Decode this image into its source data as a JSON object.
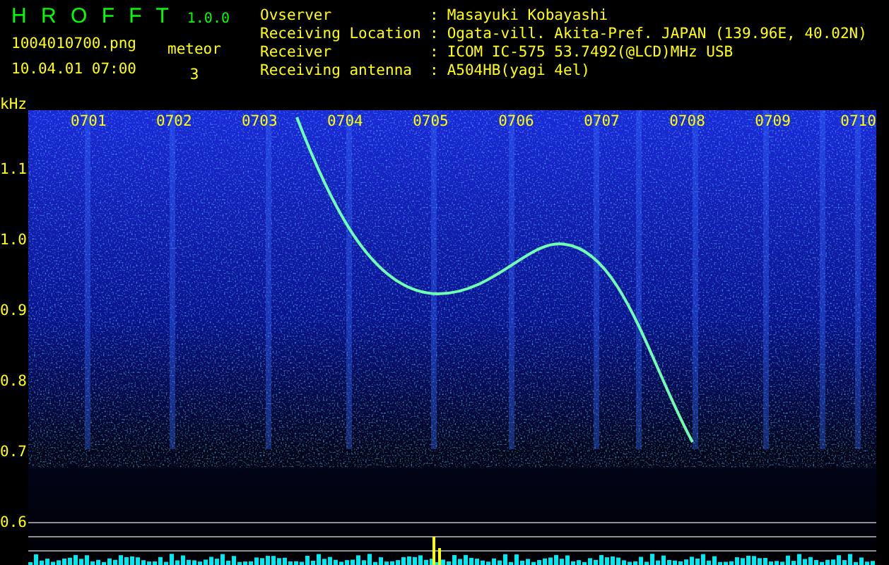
{
  "header": {
    "title": "H R O F F T",
    "version": "1.0.0",
    "file_name": "1004010700.png",
    "date_time": "10.04.01 07:00",
    "meteor_label": "meteor",
    "meteor_count": "3"
  },
  "station_info": [
    {
      "label": "Ovserver",
      "value": "Masayuki Kobayashi"
    },
    {
      "label": "Receiving Location",
      "value": "Ogata-vill. Akita-Pref. JAPAN (139.96E, 40.02N)"
    },
    {
      "label": "Receiver",
      "value": "ICOM IC-575 53.7492(@LCD)MHz USB"
    },
    {
      "label": "Receiving antenna",
      "value": "A504HB(yagi 4el)"
    }
  ],
  "separator": ":",
  "axis": {
    "unit": "kHz",
    "y_labels": [
      "1.1",
      "1.0",
      "0.9",
      "0.8",
      "0.7",
      "0.6"
    ],
    "time_labels": [
      "0701",
      "0702",
      "0703",
      "0704",
      "0705",
      "0706",
      "0707",
      "0708",
      "0709",
      "0710"
    ]
  }
}
